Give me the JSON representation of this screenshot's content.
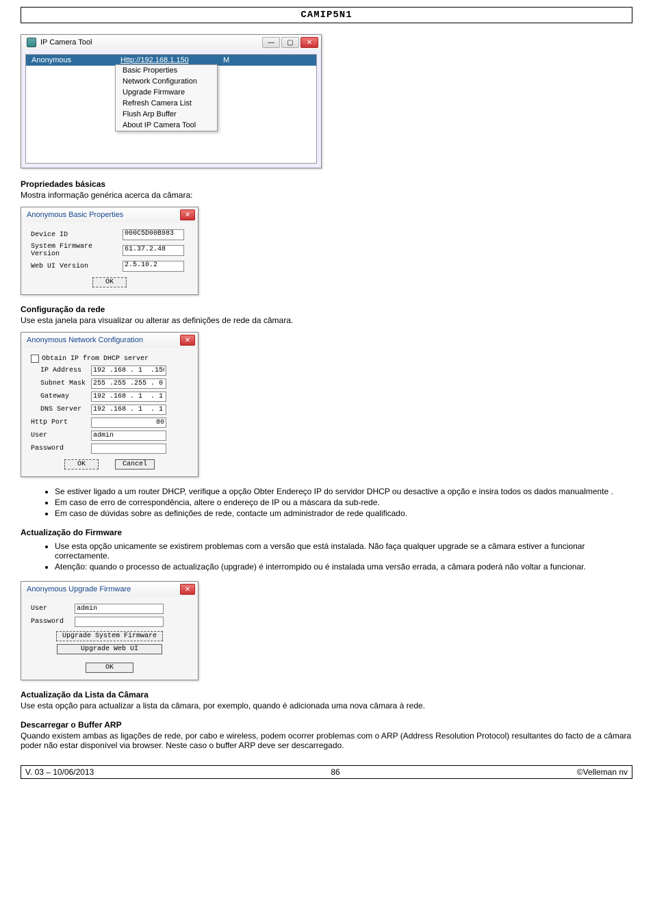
{
  "header": {
    "title": "CAMIP5N1"
  },
  "ipcam": {
    "window_title": "IP Camera Tool",
    "device_name": "Anonymous",
    "device_url": "Http://192.168.1.150",
    "device_url_tail": "M",
    "menu": [
      "Basic Properties",
      "Network Configuration",
      "Upgrade Firmware",
      "Refresh Camera List",
      "Flush Arp Buffer",
      "About IP Camera Tool"
    ]
  },
  "sec1": {
    "title": "Propriedades básicas",
    "desc": "Mostra informação genérica acerca da câmara:",
    "dialog_title": "Anonymous Basic Properties",
    "rows": {
      "device_id_lbl": "Device ID",
      "device_id_val": "000C5D00B983",
      "sysfw_lbl": "System Firmware Version",
      "sysfw_val": "61.37.2.48",
      "webui_lbl": "Web UI Version",
      "webui_val": "2.5.10.2"
    },
    "ok": "OK"
  },
  "sec2": {
    "title": "Configuração da rede",
    "desc": "Use esta janela para visualizar ou alterar as definições de rede da câmara.",
    "dialog_title": "Anonymous Network Configuration",
    "dhcp_label": "Obtain IP from DHCP server",
    "ip_lbl": "IP Address",
    "ip_val": "192 .168 . 1  .150",
    "mask_lbl": "Subnet Mask",
    "mask_val": "255 .255 .255 . 0",
    "gw_lbl": "Gateway",
    "gw_val": "192 .168 . 1  . 1",
    "dns_lbl": "DNS Server",
    "dns_val": "192 .168 . 1  . 1",
    "port_lbl": "Http Port",
    "port_val": "80",
    "user_lbl": "User",
    "user_val": "admin",
    "pwd_lbl": "Password",
    "ok": "OK",
    "cancel": "Cancel"
  },
  "bullets1": [
    "Se estiver ligado a um router DHCP, verifique a opção Obter Endereço IP do servidor DHCP ou desactive a opção e insira todos os dados manualmente .",
    "Em caso de erro de correspondência, altere o endereço de IP ou a máscara da sub-rede.",
    "Em caso de dúvidas sobre as definições de rede, contacte um administrador de rede qualificado."
  ],
  "sec3": {
    "title": "Actualização do Firmware",
    "bullets": [
      "Use esta opção unicamente se existirem problemas com a versão que está instalada. Não faça qualquer upgrade se a câmara estiver a funcionar correctamente.",
      "Atenção: quando o processo de actualização (upgrade) é interrompido ou é instalada uma versão errada, a câmara poderá não voltar a funcionar."
    ],
    "dialog_title": "Anonymous Upgrade Firmware",
    "user_lbl": "User",
    "user_val": "admin",
    "pwd_lbl": "Password",
    "btn1": "Upgrade System Firmware",
    "btn2": "Upgrade Web UI",
    "ok": "OK"
  },
  "sec4": {
    "title": "Actualização da Lista da Câmara",
    "desc": "Use esta opção para actualizar a lista da câmara, por exemplo, quando é adicionada uma nova câmara à rede."
  },
  "sec5": {
    "title": "Descarregar o Buffer ARP",
    "desc": "Quando existem ambas as ligações de rede, por cabo e wireless,  podem ocorrer problemas com o ARP (Address Resolution Protocol) resultantes do facto de a câmara poder não estar disponível via browser. Neste caso o buffer ARP deve ser descarregado."
  },
  "footer": {
    "left": "V. 03 – 10/06/2013",
    "center": "86",
    "right": "©Velleman nv"
  }
}
